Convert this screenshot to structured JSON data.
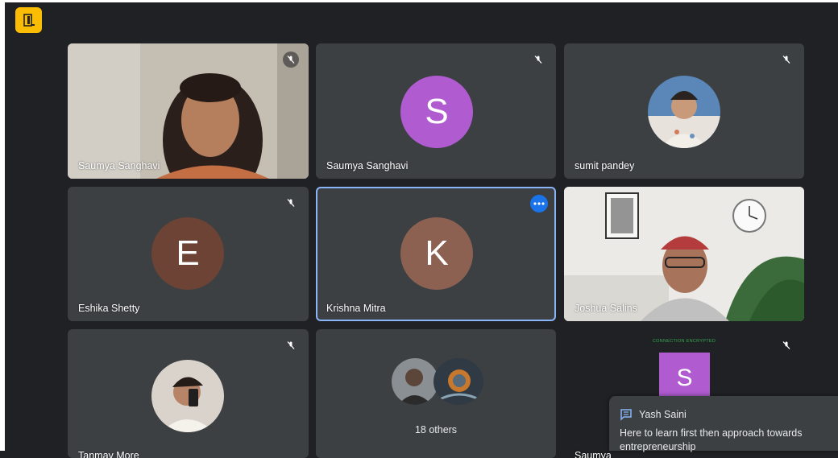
{
  "exit_button": {
    "icon": "door-exit-icon",
    "color": "#fbbc04"
  },
  "tiles": [
    {
      "id": "t1",
      "name": "Saumya Sanghavi",
      "kind": "video",
      "muted": true
    },
    {
      "id": "t2",
      "name": "Saumya Sanghavi",
      "kind": "letter",
      "letter": "S",
      "avatar_color": "#b05cd0",
      "muted": true
    },
    {
      "id": "t3",
      "name": "sumit pandey",
      "kind": "photo",
      "muted": true
    },
    {
      "id": "t4",
      "name": "Eshika Shetty",
      "kind": "letter",
      "letter": "E",
      "avatar_color": "#6d4335",
      "muted": true
    },
    {
      "id": "t5",
      "name": "Krishna Mitra",
      "kind": "letter",
      "letter": "K",
      "avatar_color": "#8d6152",
      "active": true
    },
    {
      "id": "t6",
      "name": "Joshua Salins",
      "kind": "video",
      "muted": false
    },
    {
      "id": "t7",
      "name": "Tanmay More",
      "kind": "photo",
      "muted": true
    },
    {
      "id": "t8",
      "label": "18 others",
      "kind": "group"
    },
    {
      "id": "t9",
      "name": "Saumya",
      "kind": "letter",
      "letter": "S",
      "avatar_color": "#b05cd0",
      "muted": true,
      "connection_text": "CONNECTION ENCRYPTED"
    }
  ],
  "chat_toast": {
    "sender": "Yash Saini",
    "message": "Here to learn first then approach towards entrepreneurship",
    "icon": "chat-icon"
  },
  "colors": {
    "background": "#202124",
    "tile": "#3c4043",
    "accent": "#8ab4f8"
  }
}
